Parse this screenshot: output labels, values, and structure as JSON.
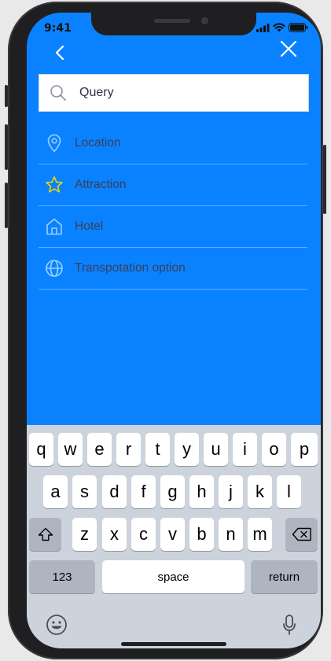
{
  "status_bar": {
    "time": "9:41"
  },
  "search": {
    "placeholder": "Query",
    "value": ""
  },
  "menu": {
    "items": [
      {
        "label": "Location",
        "icon": "location-pin-icon"
      },
      {
        "label": "Attraction",
        "icon": "star-icon"
      },
      {
        "label": "Hotel",
        "icon": "home-icon"
      },
      {
        "label": "Transpotation option",
        "icon": "globe-icon"
      }
    ]
  },
  "keyboard": {
    "row1": [
      "q",
      "w",
      "e",
      "r",
      "t",
      "y",
      "u",
      "i",
      "o",
      "p"
    ],
    "row2": [
      "a",
      "s",
      "d",
      "f",
      "g",
      "h",
      "j",
      "k",
      "l"
    ],
    "row3": [
      "z",
      "x",
      "c",
      "v",
      "b",
      "n",
      "m"
    ],
    "numbers_key": "123",
    "space_key": "space",
    "return_key": "return"
  },
  "colors": {
    "screen_background": "#0a82ff",
    "keyboard_background": "#cdd3dc",
    "star_icon": "#f5d400",
    "line_icon": "#9ad2ff"
  }
}
